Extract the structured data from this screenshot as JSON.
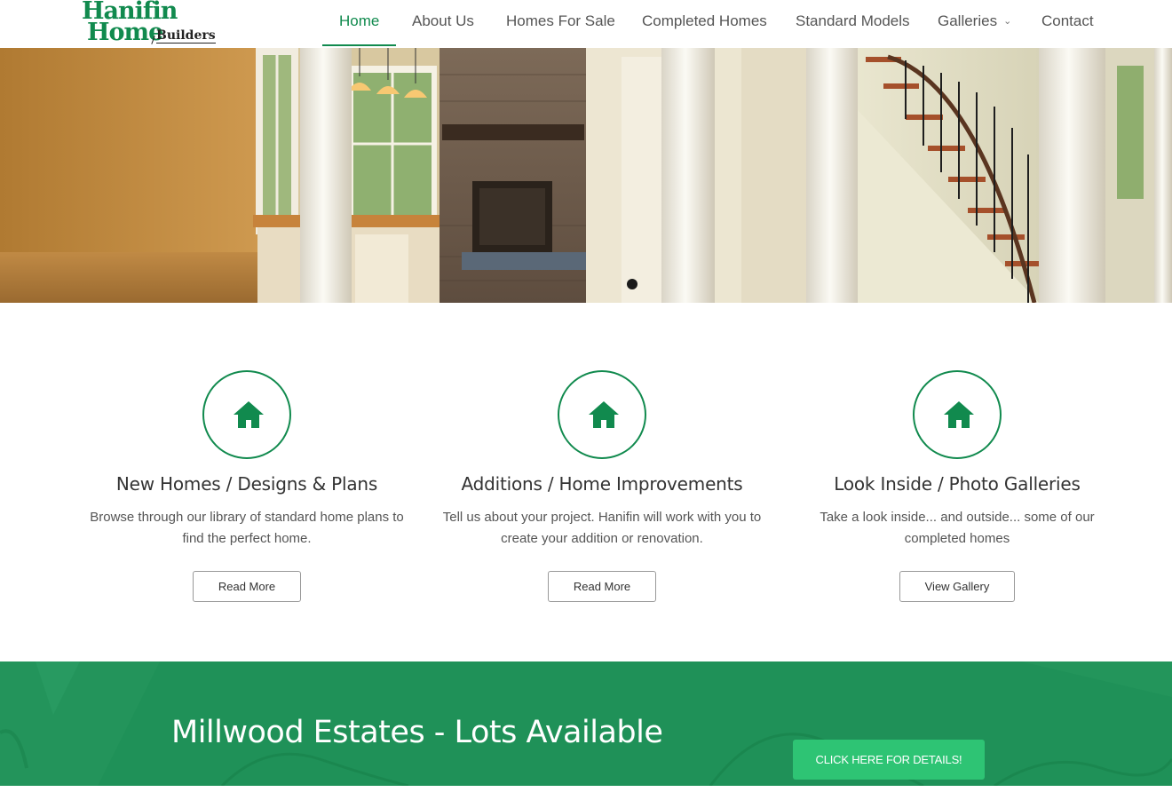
{
  "logo": {
    "line1": "Hanifin",
    "line2": "Home",
    "line3": "Builders"
  },
  "nav": {
    "items": [
      {
        "label": "Home",
        "active": true
      },
      {
        "label": "About Us"
      },
      {
        "label": "Homes For Sale"
      },
      {
        "label": "Completed Homes"
      },
      {
        "label": "Standard Models"
      },
      {
        "label": "Galleries",
        "dropdown": true
      },
      {
        "label": "Contact"
      }
    ]
  },
  "features": [
    {
      "icon": "home-icon",
      "title": "New Homes / Designs & Plans",
      "desc": "Browse through our library of standard home plans to find the perfect home.",
      "button": "Read More"
    },
    {
      "icon": "home-icon",
      "title": "Additions / Home Improvements",
      "desc": "Tell us about your project. Hanifin will work with you to create your addition or renovation.",
      "button": "Read More"
    },
    {
      "icon": "home-icon",
      "title": "Look Inside / Photo Galleries",
      "desc": "Take a look inside... and outside... some of our completed homes",
      "button": "View Gallery"
    }
  ],
  "banner": {
    "title": "Millwood Estates - Lots Available",
    "button": "CLICK HERE FOR DETAILS!"
  },
  "colors": {
    "brand_green": "#118a4e",
    "banner_green": "#1f9158",
    "button_green": "#2ec474"
  }
}
